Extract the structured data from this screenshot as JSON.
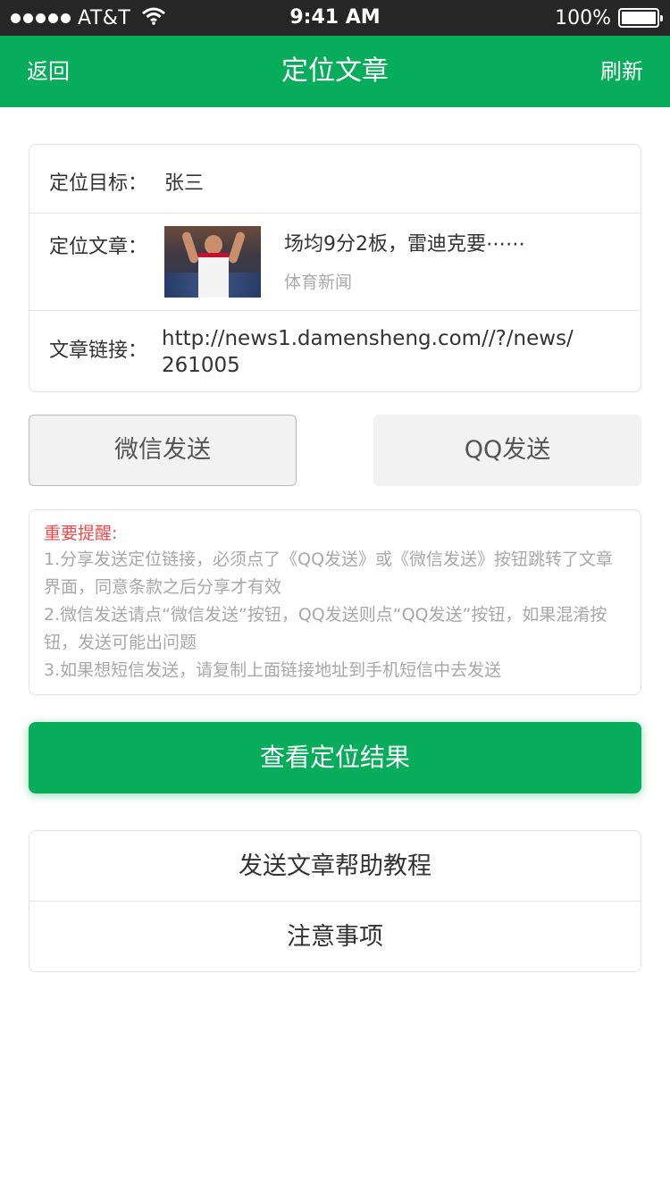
{
  "status_bar": {
    "carrier": "AT&T",
    "time": "9:41 AM",
    "battery": "100%",
    "signal_icon": "signal-dots-icon",
    "wifi_icon": "wifi-icon",
    "battery_icon": "battery-icon"
  },
  "nav": {
    "back_label": "返回",
    "title": "定位文章",
    "refresh_label": "刷新",
    "background_color": "#07ad5a"
  },
  "info": {
    "target_label": "定位目标：",
    "target_value": "张三",
    "article_label": "定位文章：",
    "article_title": "场均9分2板，雷迪克要⋯⋯",
    "article_category": "体育新闻",
    "link_label": "文章链接：",
    "link_value": "http://news1.damensheng.com//?/news/261005"
  },
  "share": {
    "wechat_label": "微信发送",
    "qq_label": "QQ发送"
  },
  "notice": {
    "title": "重要提醒:",
    "items": [
      "1.分享发送定位链接，必须点了《QQ发送》或《微信发送》按钮跳转了文章界面，同意条款之后分享才有效",
      "2.微信发送请点“微信发送”按钮，QQ发送则点“QQ发送”按钮，如果混淆按钮，发送可能出问题",
      "3.如果想短信发送，请复制上面链接地址到手机短信中去发送"
    ],
    "title_color": "#ee4a4a"
  },
  "actions": {
    "view_result_label": "查看定位结果"
  },
  "help": {
    "tutorial_label": "发送文章帮助教程",
    "notes_label": "注意事项"
  }
}
